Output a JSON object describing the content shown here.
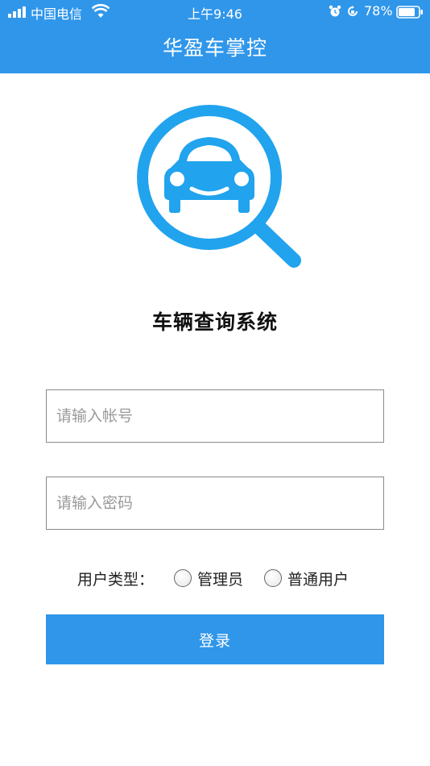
{
  "status_bar": {
    "carrier": "中国电信",
    "time": "上午9:46",
    "battery": "78%"
  },
  "header": {
    "title": "华盈车掌控"
  },
  "logo": {
    "icon": "car-magnifier-icon"
  },
  "system_title": "车辆查询系统",
  "form": {
    "account_placeholder": "请输入帐号",
    "password_placeholder": "请输入密码",
    "user_type_label": "用户类型：",
    "options": [
      "管理员",
      "普通用户"
    ],
    "login_label": "登录"
  },
  "colors": {
    "brand": "#2f96ea",
    "logo_blue": "#21a3ee"
  }
}
